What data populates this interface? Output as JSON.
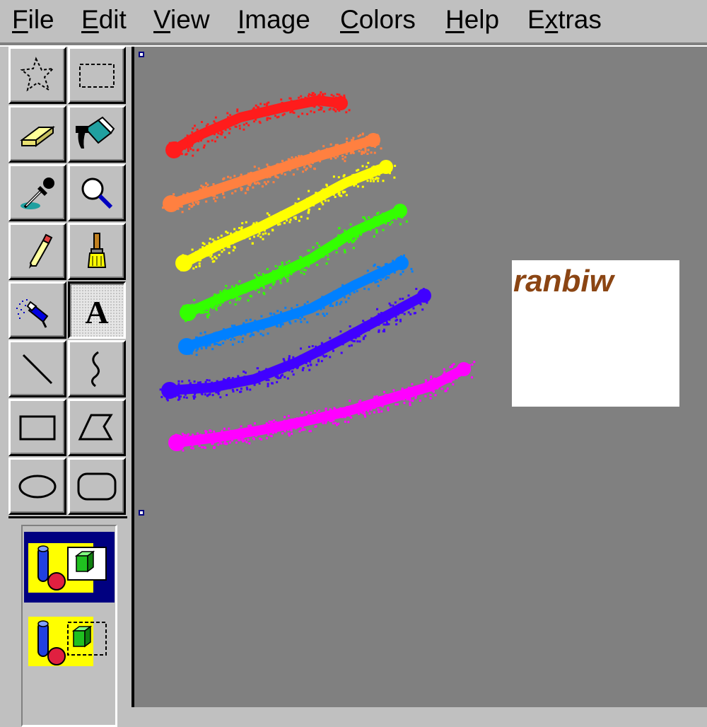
{
  "menu": [
    {
      "pre": "",
      "u": "F",
      "post": "ile"
    },
    {
      "pre": "",
      "u": "E",
      "post": "dit"
    },
    {
      "pre": "",
      "u": "V",
      "post": "iew"
    },
    {
      "pre": "",
      "u": "I",
      "post": "mage"
    },
    {
      "pre": "",
      "u": "C",
      "post": "olors"
    },
    {
      "pre": "",
      "u": "H",
      "post": "elp"
    },
    {
      "pre": "E",
      "u": "x",
      "post": "tras"
    }
  ],
  "tools": [
    {
      "name": "free-form-select-icon",
      "selected": false
    },
    {
      "name": "rectangle-select-icon",
      "selected": false
    },
    {
      "name": "eraser-icon",
      "selected": false
    },
    {
      "name": "fill-bucket-icon",
      "selected": false
    },
    {
      "name": "eyedropper-icon",
      "selected": false
    },
    {
      "name": "magnifier-icon",
      "selected": false
    },
    {
      "name": "pencil-icon",
      "selected": false
    },
    {
      "name": "brush-icon",
      "selected": false
    },
    {
      "name": "airbrush-icon",
      "selected": false
    },
    {
      "name": "text-tool-icon",
      "selected": true
    },
    {
      "name": "line-icon",
      "selected": false
    },
    {
      "name": "curve-icon",
      "selected": false
    },
    {
      "name": "rectangle-icon",
      "selected": false
    },
    {
      "name": "polygon-icon",
      "selected": false
    },
    {
      "name": "ellipse-icon",
      "selected": false
    },
    {
      "name": "rounded-rectangle-icon",
      "selected": false
    }
  ],
  "text_tool": {
    "text": "ranbiw",
    "text_color": "#8b4513",
    "options": [
      {
        "name": "opaque-background-option-icon",
        "selected": true
      },
      {
        "name": "transparent-background-option-icon",
        "selected": false
      }
    ]
  },
  "canvas": {
    "background": "#808080",
    "strokes": [
      {
        "name": "red-stroke",
        "color": "#ff1c1c"
      },
      {
        "name": "orange-stroke",
        "color": "#ff8040"
      },
      {
        "name": "yellow-stroke",
        "color": "#ffff00"
      },
      {
        "name": "green-stroke",
        "color": "#33ff00"
      },
      {
        "name": "blue-stroke",
        "color": "#0080ff"
      },
      {
        "name": "indigo-stroke",
        "color": "#4000ff"
      },
      {
        "name": "magenta-stroke",
        "color": "#ff00ff"
      }
    ]
  }
}
